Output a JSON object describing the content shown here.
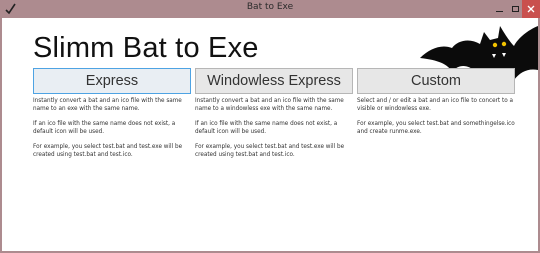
{
  "window": {
    "title": "Bat to Exe",
    "colors": {
      "frame": "#ad8b8f",
      "close": "#c9504e",
      "accent": "#4ea3e3"
    }
  },
  "header": {
    "title": "Slimm Bat to Exe",
    "logo_icon": "bat-logo-icon"
  },
  "modes": [
    {
      "label": "Express",
      "selected": true,
      "desc": [
        "Instantly convert a bat and an ico file with the same name to an exe with the same name.",
        "If an ico file with the same name does not exist, a default icon will be used.",
        "For example, you select test.bat and test.exe will be created using test.bat and test.ico."
      ]
    },
    {
      "label": "Windowless Express",
      "selected": false,
      "desc": [
        "Instantly convert a bat and an ico file with the same name to a windowless exe with the same name.",
        "If an ico file with the same name does not exist, a default icon will be used.",
        "For example, you select test.bat and test.exe will be created using test.bat and test.ico."
      ]
    },
    {
      "label": "Custom",
      "selected": false,
      "desc": [
        "Select and / or edit a bat and an ico file to concert to a visible or windowless exe.",
        "For example, you select test.bat and somethingelse.ico and create runme.exe."
      ]
    }
  ]
}
